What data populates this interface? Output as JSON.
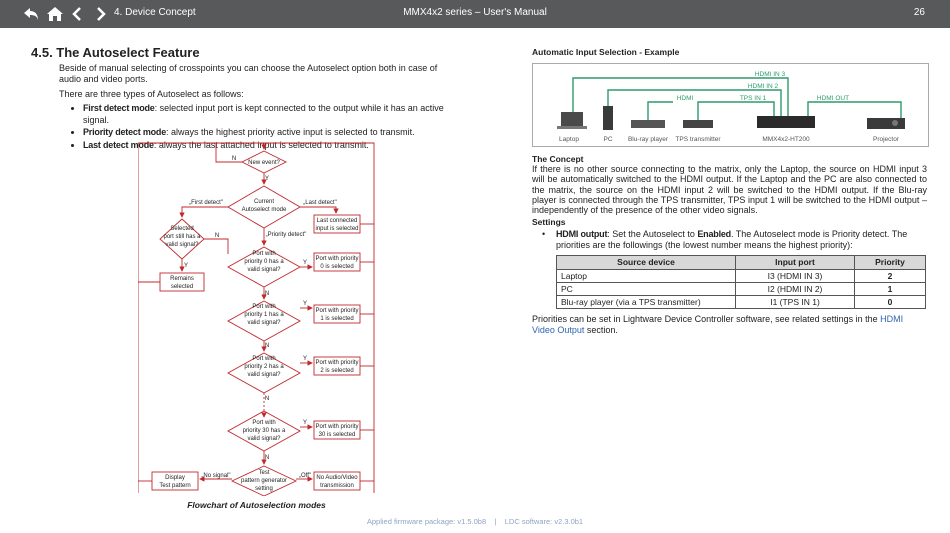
{
  "header": {
    "chapter": "4. Device Concept",
    "title": "MMX4x2 series – User's Manual",
    "page_number": "26",
    "nav_icons": [
      "back-icon",
      "home-icon",
      "previous-icon",
      "next-icon"
    ]
  },
  "section": {
    "heading": "4.5. The Autoselect Feature",
    "intro": "Beside of manual selecting of crosspoints you can choose the Autoselect option both in case of audio and video ports.",
    "types_intro": "There are three types of Autoselect as follows:",
    "modes": [
      {
        "name": "First detect mode",
        "desc": ": selected input port is kept connected to the output while it has an active signal."
      },
      {
        "name": "Priority detect mode",
        "desc": ": always the highest priority active input is selected to transmit."
      },
      {
        "name": "Last detect mode",
        "desc": ": always the last attached input is selected to transmit."
      }
    ]
  },
  "flowchart": {
    "caption": "Flowchart of Autoselection modes",
    "new_event": "New event?",
    "n": "N",
    "y": "Y",
    "current_1": "Current",
    "current_2": "Autoselect mode",
    "first_detect": "„First detect\"",
    "last_detect": "„Last detect\"",
    "priority_detect": "„Priority detect\"",
    "selected_1": "Selected",
    "selected_2": "port still has a",
    "selected_3": "valid signal?",
    "remains_1": "Remains",
    "remains_2": "selected",
    "last_conn_1": "Last connected",
    "last_conn_2": "input is selected",
    "p0_1": "Port with",
    "p0_2": "priority 0 has a",
    "p0_3": "valid signal?",
    "p0_sel_1": "Port with priority",
    "p0_sel_2": "0 is selected",
    "p1_1": "Port with",
    "p1_2": "priority 1 has a",
    "p1_3": "valid signal?",
    "p1_sel_1": "Port with priority",
    "p1_sel_2": "1 is selected",
    "p2_1": "Port with",
    "p2_2": "priority 2 has a",
    "p2_3": "valid signal?",
    "p2_sel_1": "Port with priority",
    "p2_sel_2": "2 is selected",
    "p30_1": "Port with",
    "p30_2": "priority 30 has a",
    "p30_3": "valid signal?",
    "p30_sel_1": "Port with priority",
    "p30_sel_2": "30 is selected",
    "test_1": "Test",
    "test_2": "pattern generator",
    "test_3": "setting",
    "no_signal": "„No signal\"",
    "off": "„Off\"",
    "display_1": "Display",
    "display_2": "Test pattern",
    "noav_1": "No Audio/Video",
    "noav_2": "transmission",
    "colour": "#c0282d"
  },
  "example": {
    "heading": "Automatic Input Selection - Example",
    "hdmi_in3": "HDMI IN 3",
    "hdmi_in2": "HDMI IN 2",
    "hdmi": "HDMI",
    "tps_in1": "TPS IN 1",
    "hdmi_out": "HDMI OUT",
    "devices": [
      "Laptop",
      "PC",
      "Blu-ray player",
      "TPS transmitter",
      "MMX4x2-HT200",
      "Projector"
    ],
    "line_colour": "#2e9b6b"
  },
  "concept": {
    "heading": "The Concept",
    "text": "If there is no other source connecting to the matrix, only the Laptop, the source on HDMI input 3 will be automatically switched to the HDMI output. If the Laptop and the PC are also connected to the matrix, the source on the HDMI input 2 will be switched to the HDMI output. If the Blu-ray player is connected through the TPS transmitter, TPS input 1 will be switched to the HDMI output – independently of the presence of the other video signals.",
    "settings_heading": "Settings",
    "bullet_label": "HDMI output",
    "bullet_mid": ": Set the Autoselect to ",
    "bullet_enabled": "Enabled",
    "bullet_rest": ". The Autoselect mode is Priority detect. The priorities are the followings (the lowest number means the highest priority):",
    "table": {
      "headers": [
        "Source device",
        "Input port",
        "Priority"
      ],
      "rows": [
        [
          "Laptop",
          "I3 (HDMI IN 3)",
          "2"
        ],
        [
          "PC",
          "I2 (HDMI IN 2)",
          "1"
        ],
        [
          "Blu-ray player (via a TPS transmitter)",
          "I1 (TPS IN 1)",
          "0"
        ]
      ]
    },
    "closing_pre": "Priorities can be set in Lightware Device Controller software, see related settings in the ",
    "closing_link": "HDMI Video Output",
    "closing_post": " section."
  },
  "footer": {
    "text": "Applied firmware package: v1.5.0b8    |    LDC software: v2.3.0b1"
  }
}
